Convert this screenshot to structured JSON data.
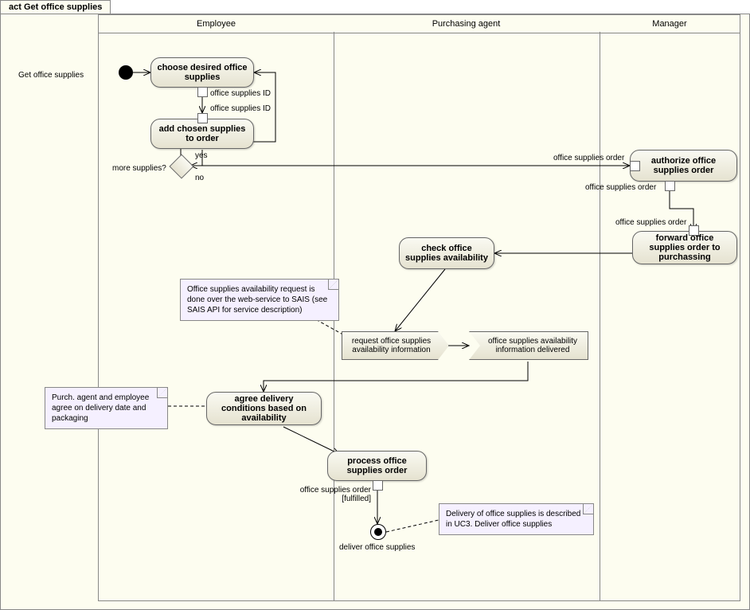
{
  "diagram": {
    "title_prefix": "act",
    "title": "Get office supplies",
    "swimlanes": {
      "employee": "Employee",
      "purchasing": "Purchasing agent",
      "manager": "Manager"
    },
    "initial_label": "Get office supplies",
    "activities": {
      "choose": "choose desired office supplies",
      "add": "add chosen supplies to order",
      "authorize": "authorize office supplies order",
      "forward": "forward office supplies order to purchassing",
      "check": "check office supplies availability",
      "agree": "agree delivery conditions based on availability",
      "process": "process office supplies order"
    },
    "signals": {
      "request": "request office supplies availability information",
      "delivered": "office supplies availability information delivered"
    },
    "decision_label": "more supplies?",
    "decision_yes": "yes",
    "decision_no": "no",
    "pins": {
      "supplies_id": "office supplies ID",
      "order": "office supplies order",
      "fulfilled": "office supplies order [fulfilled]"
    },
    "final_label": "deliver office supplies",
    "notes": {
      "sais": "Office supplies availability request is done over the web-service to SAIS (see SAIS API for service description)",
      "agree": "Purch. agent and employee agree on delivery date and packaging",
      "deliver": "Delivery of office supplies is described in UC3. Deliver office supplies"
    }
  }
}
